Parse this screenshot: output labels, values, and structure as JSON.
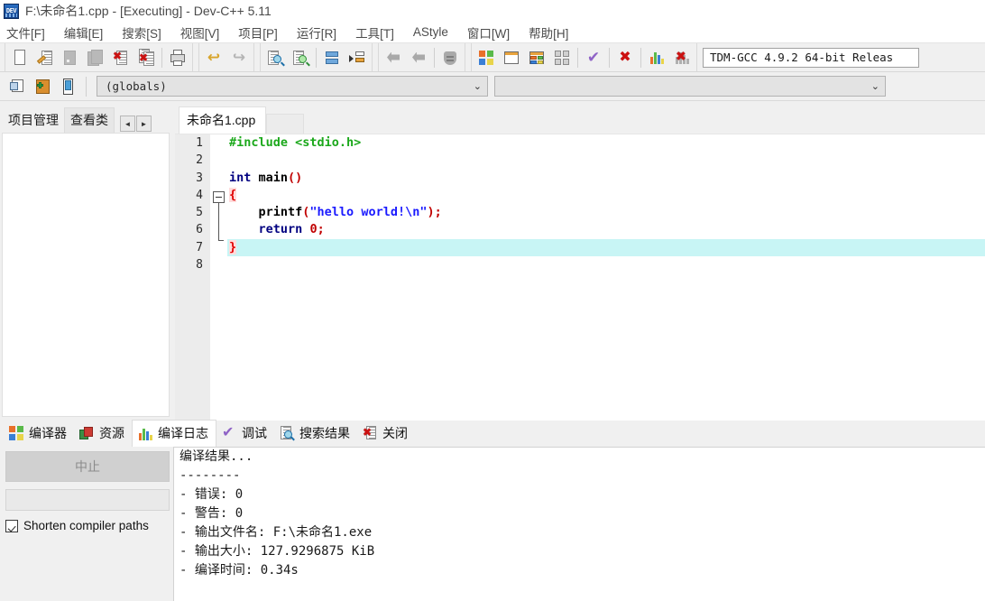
{
  "window": {
    "title": "F:\\未命名1.cpp - [Executing] - Dev-C++ 5.11",
    "icon": "devcpp-app-icon"
  },
  "menubar": {
    "items": [
      {
        "label": "文件[F]",
        "name": "menu-file"
      },
      {
        "label": "编辑[E]",
        "name": "menu-edit"
      },
      {
        "label": "搜索[S]",
        "name": "menu-search"
      },
      {
        "label": "视图[V]",
        "name": "menu-view"
      },
      {
        "label": "项目[P]",
        "name": "menu-project"
      },
      {
        "label": "运行[R]",
        "name": "menu-run"
      },
      {
        "label": "工具[T]",
        "name": "menu-tools"
      },
      {
        "label": "AStyle",
        "name": "menu-astyle"
      },
      {
        "label": "窗口[W]",
        "name": "menu-window"
      },
      {
        "label": "帮助[H]",
        "name": "menu-help"
      }
    ]
  },
  "toolbar": {
    "compiler_select_value": "TDM-GCC 4.9.2 64-bit Releas",
    "buttons": [
      "new-file-icon",
      "open-file-icon",
      "save-file-icon",
      "save-all-icon",
      "close-file-icon",
      "close-all-icon",
      "print-icon",
      "undo-icon",
      "redo-icon",
      "find-icon",
      "replace-icon",
      "goto-line-icon",
      "goto-function-icon",
      "step-back-icon",
      "step-forward-icon",
      "shield-icon",
      "compile-icon",
      "run-icon",
      "compile-run-icon",
      "rebuild-all-icon",
      "syntax-check-icon",
      "stop-execution-icon",
      "profile-icon",
      "delete-profile-icon"
    ]
  },
  "toolbar2": {
    "buttons": [
      "new-class-icon",
      "add-member-icon",
      "browse-icon"
    ],
    "globals_value": "(globals)",
    "members_value": ""
  },
  "left_panel": {
    "tabs": [
      {
        "label": "项目管理",
        "active": true,
        "name": "tab-project-manager"
      },
      {
        "label": "查看类",
        "active": false,
        "name": "tab-class-browser"
      }
    ],
    "scroll_left": "◄",
    "scroll_right": "►"
  },
  "editor": {
    "tabs": [
      {
        "label": "未命名1.cpp",
        "active": true,
        "name": "editor-tab-untitled1"
      }
    ],
    "line_numbers": [
      "1",
      "2",
      "3",
      "4",
      "5",
      "6",
      "7",
      "8"
    ],
    "active_line": 7,
    "code_lines": [
      {
        "n": 1,
        "tokens": [
          {
            "t": "#include <stdio.h>",
            "c": "inc"
          }
        ]
      },
      {
        "n": 2,
        "tokens": [
          {
            "t": "",
            "c": "id"
          }
        ]
      },
      {
        "n": 3,
        "tokens": [
          {
            "t": "int",
            "c": "kw"
          },
          {
            "t": " ",
            "c": "id"
          },
          {
            "t": "main",
            "c": "id"
          },
          {
            "t": "()",
            "c": "par"
          }
        ]
      },
      {
        "n": 4,
        "tokens": [
          {
            "t": "{",
            "c": "brace"
          }
        ]
      },
      {
        "n": 5,
        "tokens": [
          {
            "t": "    printf",
            "c": "id"
          },
          {
            "t": "(",
            "c": "par"
          },
          {
            "t": "\"hello world!\\n\"",
            "c": "str"
          },
          {
            "t": ")",
            "c": "par"
          },
          {
            "t": ";",
            "c": "punc"
          }
        ]
      },
      {
        "n": 6,
        "tokens": [
          {
            "t": "    ",
            "c": "id"
          },
          {
            "t": "return",
            "c": "kw"
          },
          {
            "t": " ",
            "c": "id"
          },
          {
            "t": "0",
            "c": "num"
          },
          {
            "t": ";",
            "c": "punc"
          }
        ]
      },
      {
        "n": 7,
        "tokens": [
          {
            "t": "}",
            "c": "brace"
          }
        ]
      },
      {
        "n": 8,
        "tokens": [
          {
            "t": "",
            "c": "id"
          }
        ]
      }
    ]
  },
  "bottom_panel": {
    "tabs": [
      {
        "label": "编译器",
        "icon": "compiler-icon",
        "active": false,
        "name": "tab-compiler"
      },
      {
        "label": "资源",
        "icon": "resources-icon",
        "active": false,
        "name": "tab-resources"
      },
      {
        "label": "编译日志",
        "icon": "compile-log-icon",
        "active": true,
        "name": "tab-compile-log"
      },
      {
        "label": "调试",
        "icon": "debug-icon",
        "active": false,
        "name": "tab-debug"
      },
      {
        "label": "搜索结果",
        "icon": "find-results-icon",
        "active": false,
        "name": "tab-find-results"
      },
      {
        "label": "关闭",
        "icon": "close-panel-icon",
        "active": false,
        "name": "tab-close"
      }
    ],
    "abort_label": "中止",
    "progress_value": "",
    "shorten_paths_label": "Shorten compiler paths",
    "shorten_paths_checked": true,
    "log_lines": [
      "编译结果...",
      "--------",
      "- 错误: 0",
      "- 警告: 0",
      "- 输出文件名: F:\\未命名1.exe",
      "- 输出大小: 127.9296875 KiB",
      "- 编译时间: 0.34s"
    ]
  },
  "colors": {
    "window_bg": "#f0f0f0",
    "editor_bg": "#ffffff",
    "gutter_bg": "#ececec",
    "active_line": "#c8f5f5",
    "preprocessor_green": "#1ba81b",
    "keyword_navy": "#000080",
    "string_blue": "#1a1aff",
    "brace_red": "#e00000",
    "paren_red": "#c00000"
  }
}
